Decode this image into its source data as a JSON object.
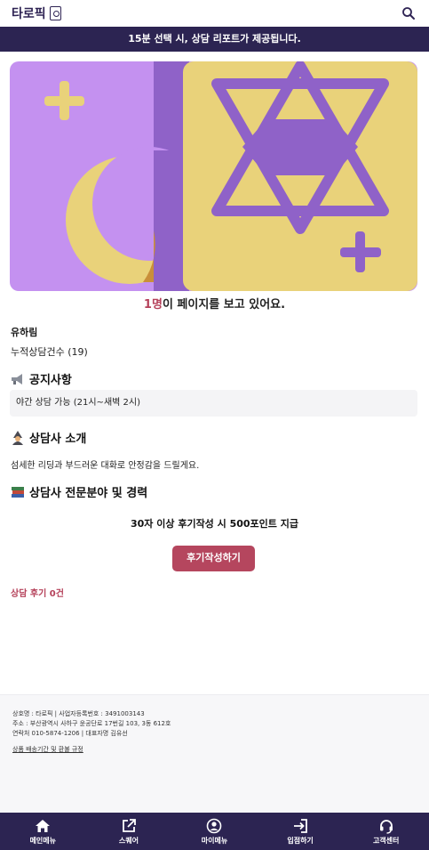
{
  "header": {
    "logo_text": "타로픽",
    "logo_icon": "tarot-card-icon",
    "search_icon": "search-icon"
  },
  "banner": {
    "text": "15분 선택 시, 상담 리포트가 제공됩니다."
  },
  "hero": {
    "colors": {
      "left_bg": "#c491f0",
      "stripe": "#8f62c8",
      "right_bg": "#e9d27a",
      "moon": "#e9d27a",
      "star": "#8f62c8",
      "plus_left": "#e9d27a",
      "plus_right": "#8f62c8"
    }
  },
  "viewers": {
    "count": "1명",
    "suffix": "이 페이지를 보고 있어요."
  },
  "counselor": {
    "name": "유하림",
    "counsel_count_label": "누적상담건수 (19)"
  },
  "notice": {
    "icon": "megaphone-icon",
    "title": "공지사항",
    "text": "야간 상담 가능 (21시~새벽 2시)"
  },
  "intro": {
    "icon": "counselor-icon",
    "title": "상담사 소개",
    "text": "섬세한 리딩과 부드러운 대화로 안정감을 드릴게요."
  },
  "expertise": {
    "icon": "books-icon",
    "title": "상담사 전문분야 및 경력"
  },
  "review": {
    "notice": "30자 이상 후기작성 시 500포인트 지급",
    "button_label": "후기작성하기",
    "count_label": "상담 후기 0건"
  },
  "footer": {
    "line1": "상호명 : 타로픽 | 사업자등록번호 : 3491003143",
    "line2": "주소 : 부산광역시 사하구 윤공단로 17번길 103, 3동 612호",
    "line3": "연락처 010-5874-1206 | 대표자명 김유선",
    "policy_link": "상품 배송기간 및 환불 규정"
  },
  "bottom_nav": [
    {
      "label": "메인메뉴",
      "icon": "home-icon"
    },
    {
      "label": "스퀘어",
      "icon": "external-link-icon"
    },
    {
      "label": "마이메뉴",
      "icon": "user-icon"
    },
    {
      "label": "입점하기",
      "icon": "login-icon"
    },
    {
      "label": "고객센터",
      "icon": "headset-icon"
    }
  ],
  "theme": {
    "primary": "#2c2452",
    "accent": "#b5465e"
  }
}
